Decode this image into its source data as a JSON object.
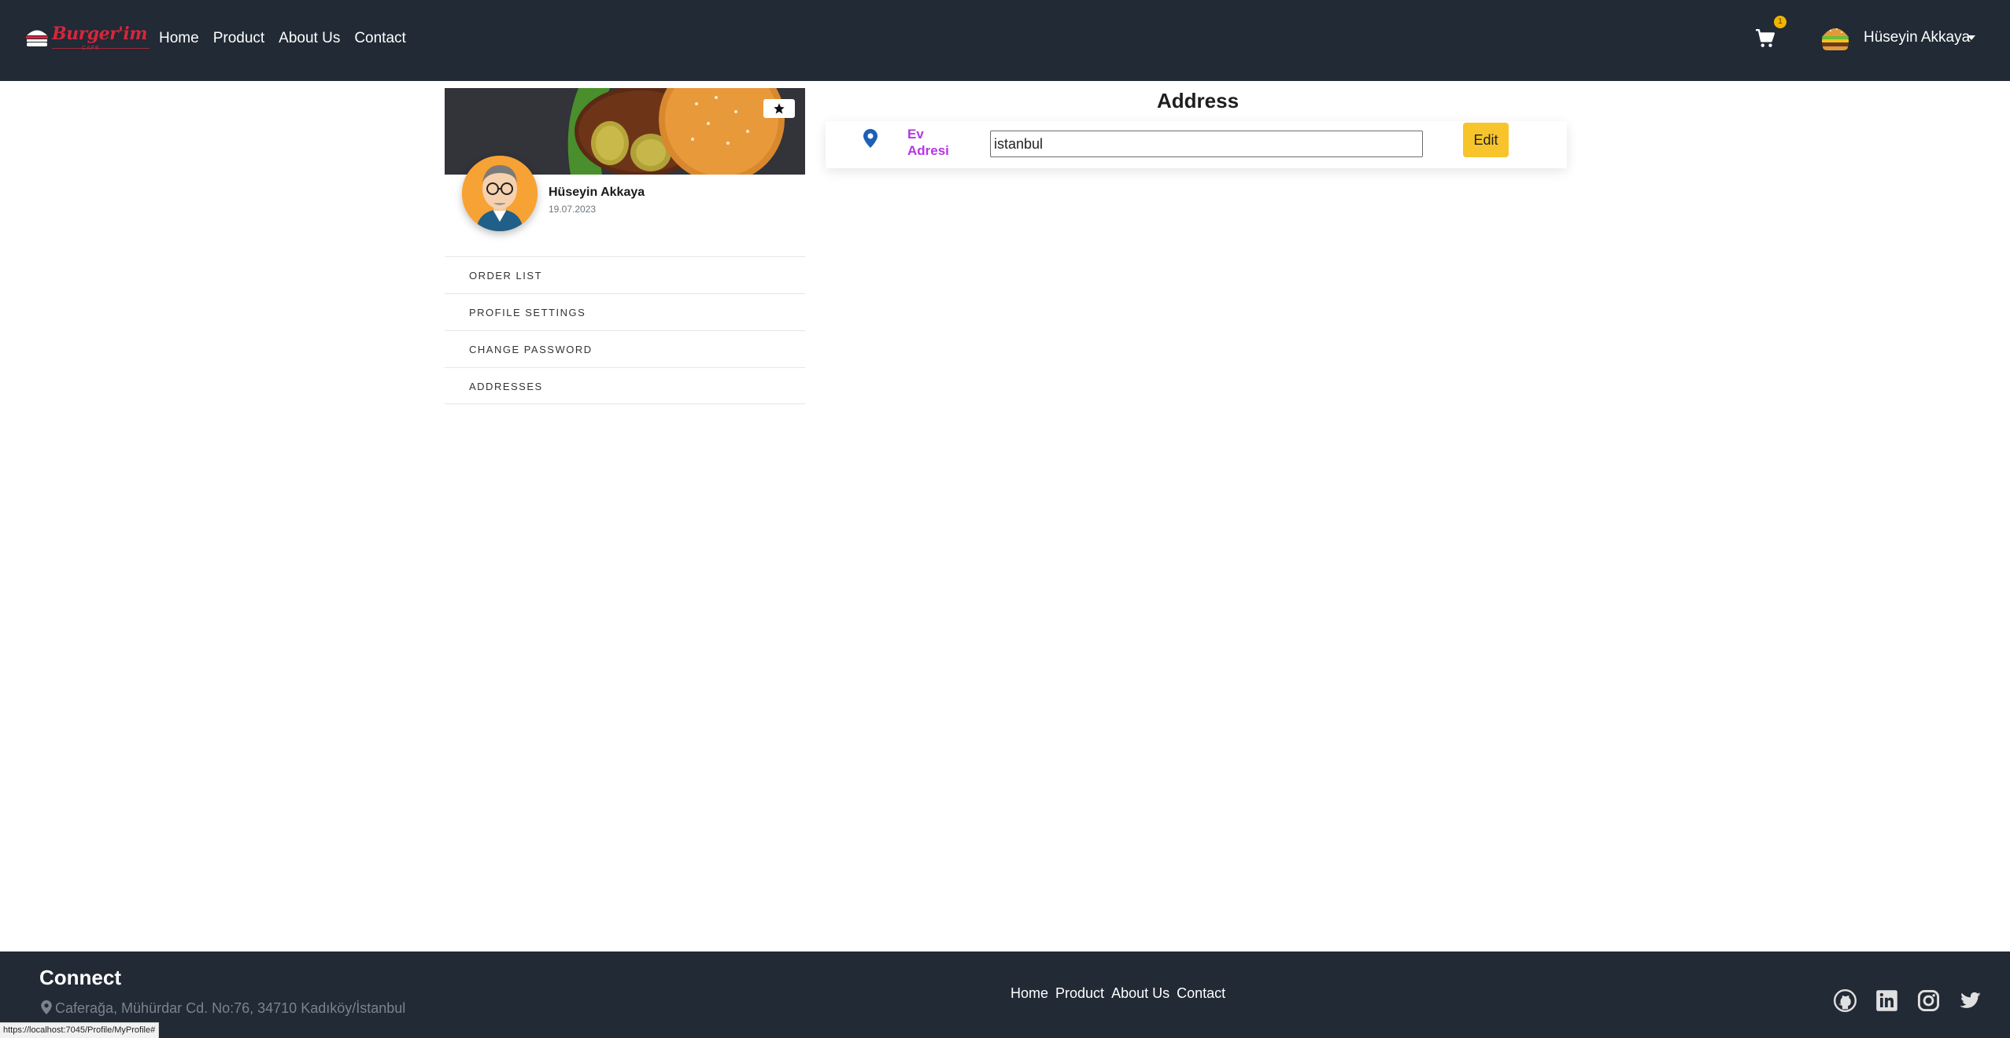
{
  "navbar": {
    "brand": {
      "name": "Burger'im",
      "sub": "CAFE"
    },
    "links": [
      "Home",
      "Product",
      "About Us",
      "Contact"
    ],
    "cart_count": "1",
    "user_name": "Hüseyin Akkaya"
  },
  "profile": {
    "name": "Hüseyin Akkaya",
    "date": "19.07.2023",
    "menu": [
      "ORDER LIST",
      "PROFILE SETTINGS",
      "CHANGE PASSWORD",
      "ADDRESSES"
    ]
  },
  "address": {
    "title": "Address",
    "label": "Ev Adresi",
    "value": "istanbul",
    "edit_label": "Edit"
  },
  "footer": {
    "title": "Connect",
    "address": "Caferağa, Mühürdar Cd. No:76, 34710 Kadıköy/İstanbul",
    "links": [
      "Home",
      "Product",
      "About Us",
      "Contact"
    ],
    "socials": [
      "github-icon",
      "linkedin-icon",
      "instagram-icon",
      "twitter-icon"
    ]
  },
  "status_url": "https://localhost:7045/Profile/MyProfile#",
  "colors": {
    "navbar_bg": "#212a35",
    "accent_yellow": "#f7c52b",
    "label_purple": "#b535e6",
    "pin_blue": "#1c5fb8",
    "brand_red": "#d7263d"
  }
}
